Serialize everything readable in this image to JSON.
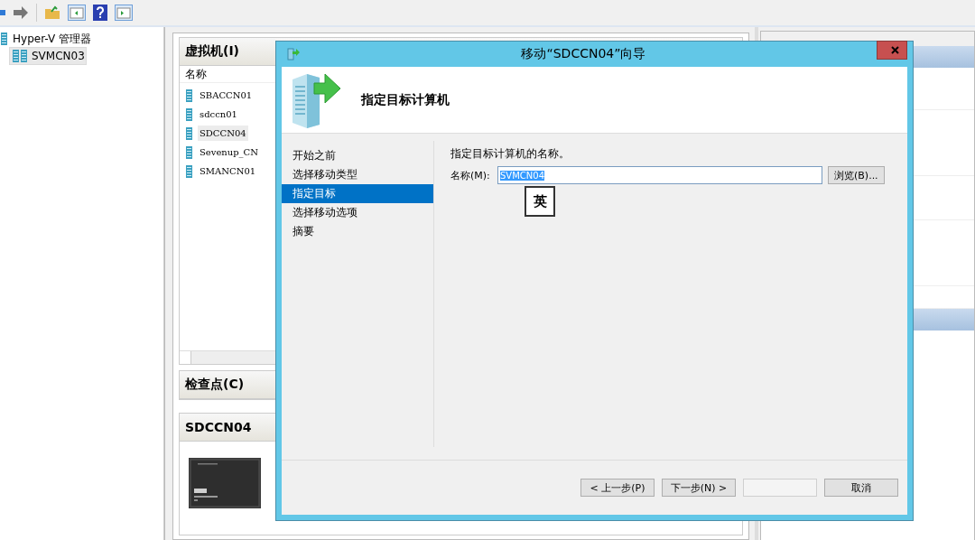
{
  "tree": [
    {
      "label": "Hyper-V 管理器",
      "children": [
        {
          "label": "SVMCN03",
          "selected": true
        }
      ]
    }
  ],
  "vm_panel": {
    "title": "虚拟机(I)",
    "columns": [
      "名称"
    ],
    "rows": [
      {
        "name": "SBACCN01",
        "selected": false
      },
      {
        "name": "sdccn01",
        "selected": false
      },
      {
        "name": "SDCCN04",
        "selected": true
      },
      {
        "name": "Sevenup_CN",
        "selected": false
      },
      {
        "name": "SMANCN01",
        "selected": false
      }
    ]
  },
  "checkpoints": {
    "title": "检查点(C)"
  },
  "details": {
    "title": "SDCCN04"
  },
  "dialog": {
    "title": "移动“SDCCN04”向导",
    "heading": "指定目标计算机",
    "steps": [
      {
        "label": "开始之前",
        "selected": false
      },
      {
        "label": "选择移动类型",
        "selected": false
      },
      {
        "label": "指定目标",
        "selected": true
      },
      {
        "label": "选择移动选项",
        "selected": false
      },
      {
        "label": "摘要",
        "selected": false
      }
    ],
    "prompt": "指定目标计算机的名称。",
    "name_label": "名称(M):",
    "name_value": "SVMCN04",
    "name_selected": true,
    "browse_button": "浏览(B)...",
    "ime_indicator": "英",
    "buttons": [
      {
        "label": "< 上一步(P)",
        "disabled": false
      },
      {
        "label": "下一步(N) >",
        "disabled": false
      },
      {
        "disabled": true
      },
      {
        "label": "取消",
        "disabled": false
      }
    ]
  }
}
